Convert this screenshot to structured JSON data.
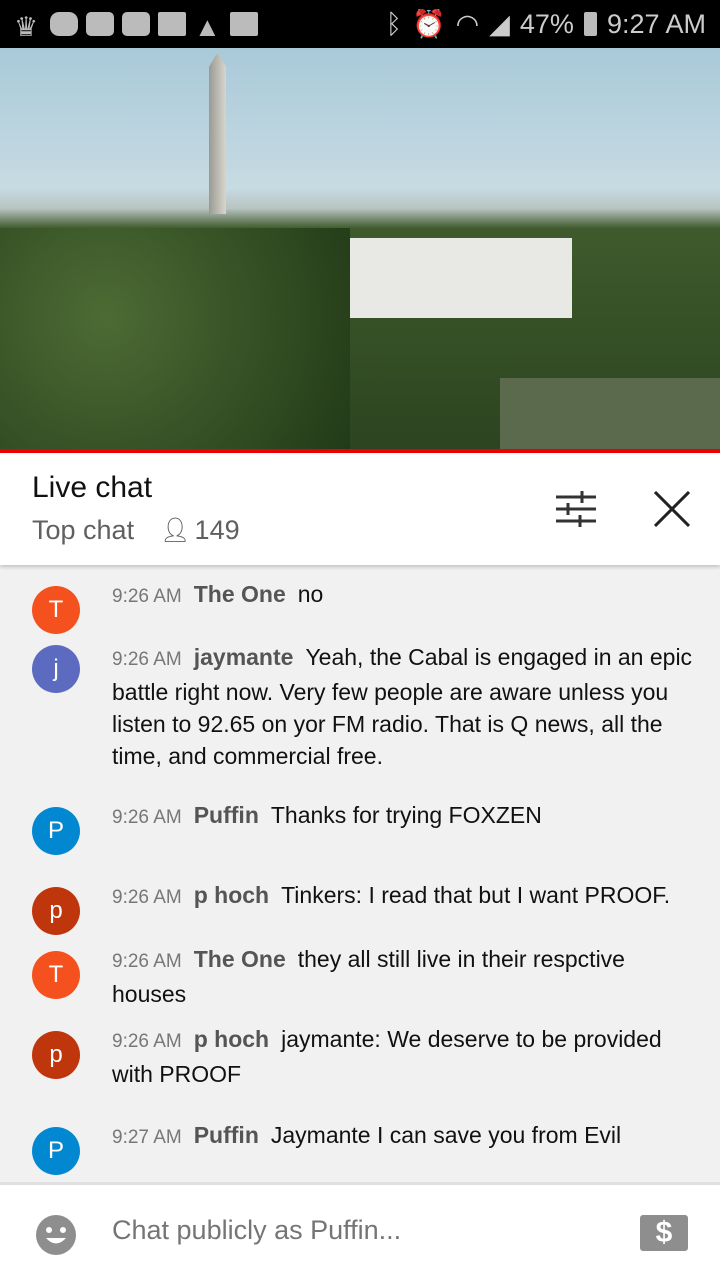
{
  "status_bar": {
    "battery": "47%",
    "time": "9:27 AM"
  },
  "header": {
    "title": "Live chat",
    "mode": "Top chat",
    "viewers": "149"
  },
  "messages": [
    {
      "initial": "T",
      "color": "#f4511e",
      "time": "9:26 AM",
      "author": "The One",
      "text": "no"
    },
    {
      "initial": "j",
      "color": "#5c6bc0",
      "time": "9:26 AM",
      "author": "jaymante",
      "text": "Yeah, the Cabal is engaged in an epic battle right now. Very few people are aware unless you listen to 92.65 on yor FM radio. That is Q news, all the time, and commercial free."
    },
    {
      "initial": "P",
      "color": "#0288d1",
      "time": "9:26 AM",
      "author": "Puffin",
      "text": "Thanks for trying FOXZEN"
    },
    {
      "initial": "p",
      "color": "#bf360c",
      "time": "9:26 AM",
      "author": "p hoch",
      "text": "Tinkers: I read that but I want PROOF."
    },
    {
      "initial": "T",
      "color": "#f4511e",
      "time": "9:26 AM",
      "author": "The One",
      "text": "they all still live in their respctive houses"
    },
    {
      "initial": "p",
      "color": "#bf360c",
      "time": "9:26 AM",
      "author": "p hoch",
      "text": "jaymante: We deserve to be provided with PROOF"
    },
    {
      "initial": "P",
      "color": "#0288d1",
      "time": "9:27 AM",
      "author": "Puffin",
      "text": "Jaymante I can save you from Evil"
    }
  ],
  "input": {
    "placeholder": "Chat publicly as Puffin..."
  }
}
